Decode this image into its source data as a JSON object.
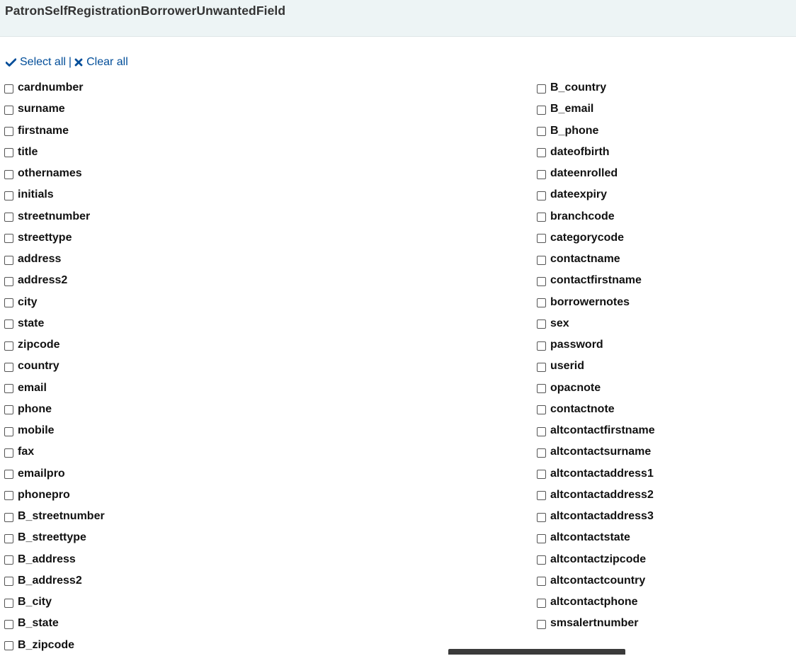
{
  "header": {
    "title": "PatronSelfRegistrationBorrowerUnwantedField"
  },
  "actions": {
    "select_all": "Select all",
    "separator": "|",
    "clear_all": "Clear all"
  },
  "fields_left": [
    "cardnumber",
    "surname",
    "firstname",
    "title",
    "othernames",
    "initials",
    "streetnumber",
    "streettype",
    "address",
    "address2",
    "city",
    "state",
    "zipcode",
    "country",
    "email",
    "phone",
    "mobile",
    "fax",
    "emailpro",
    "phonepro",
    "B_streetnumber",
    "B_streettype",
    "B_address",
    "B_address2",
    "B_city",
    "B_state",
    "B_zipcode"
  ],
  "fields_right": [
    "B_country",
    "B_email",
    "B_phone",
    "dateofbirth",
    "dateenrolled",
    "dateexpiry",
    "branchcode",
    "categorycode",
    "contactname",
    "contactfirstname",
    "borrowernotes",
    "sex",
    "password",
    "userid",
    "opacnote",
    "contactnote",
    "altcontactfirstname",
    "altcontactsurname",
    "altcontactaddress1",
    "altcontactaddress2",
    "altcontactaddress3",
    "altcontactstate",
    "altcontactzipcode",
    "altcontactcountry",
    "altcontactphone",
    "smsalertnumber"
  ],
  "colors": {
    "header_bg": "#edf4f5",
    "link": "#004d99",
    "label": "#111111"
  }
}
